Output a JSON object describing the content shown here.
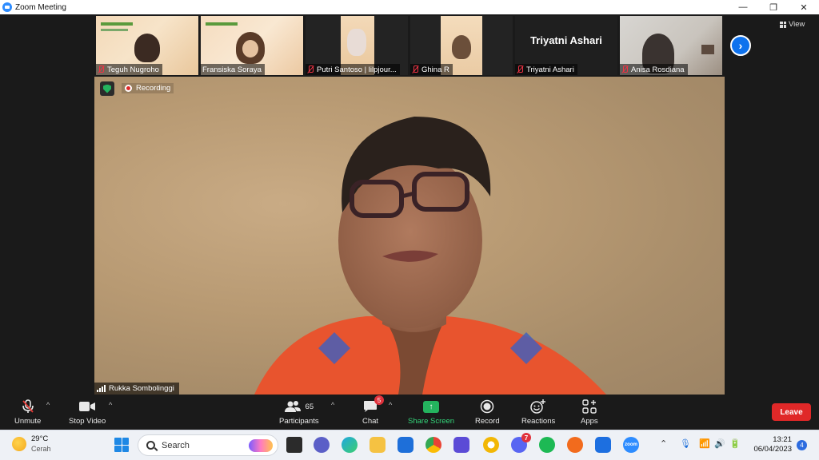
{
  "window": {
    "title": "Zoom Meeting",
    "controls": [
      "—",
      "❐",
      "✕"
    ]
  },
  "view_button": {
    "label": "View"
  },
  "participants_strip": [
    {
      "name": "Teguh Nugroho",
      "muted": true,
      "bg": "event"
    },
    {
      "name": "Fransiska Soraya",
      "muted": false,
      "bg": "event"
    },
    {
      "name": "Putri Santoso | lilpjour...",
      "muted": true,
      "bg": "event"
    },
    {
      "name": "Ghina R",
      "muted": true,
      "bg": "event"
    },
    {
      "name": "Triyatni Ashari",
      "card_name": "Triyatni Ashari",
      "muted": true,
      "bg": "card"
    },
    {
      "name": "Anisa Rosdiana",
      "muted": true,
      "bg": "room"
    }
  ],
  "main_video": {
    "recording_label": "Recording",
    "speaker_name": "Rukka Sombolinggi"
  },
  "toolbar": {
    "unmute": "Unmute",
    "stop_video": "Stop Video",
    "participants": "Participants",
    "participants_count": "65",
    "chat": "Chat",
    "chat_badge": "5",
    "share_screen": "Share Screen",
    "record": "Record",
    "reactions": "Reactions",
    "apps": "Apps",
    "leave": "Leave"
  },
  "taskbar": {
    "weather_temp": "29°C",
    "weather_cond": "Cerah",
    "search_placeholder": "Search",
    "discord_badge": "7",
    "time": "13:21",
    "date": "06/04/2023",
    "notifications": "4"
  },
  "colors": {
    "accent": "#0e72ed",
    "leave": "#e02828",
    "share": "#24b35e"
  }
}
